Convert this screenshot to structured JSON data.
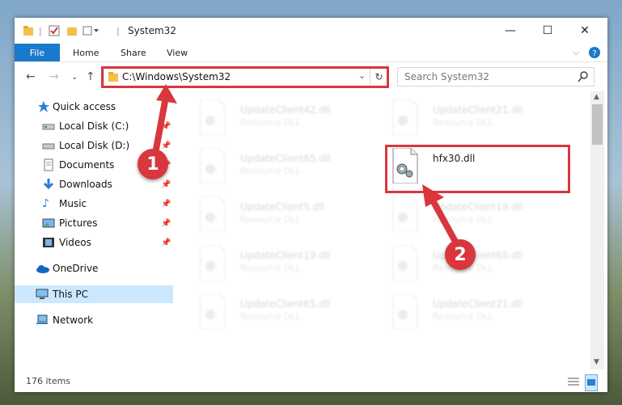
{
  "window": {
    "title": "System32",
    "controls": {
      "minimize": "—",
      "maximize": "☐",
      "close": "✕"
    }
  },
  "ribbon": {
    "tabs": [
      "File",
      "Home",
      "Share",
      "View"
    ]
  },
  "nav": {
    "address": "C:\\Windows\\System32",
    "search_placeholder": "Search System32"
  },
  "sidebar": {
    "items": [
      {
        "label": "Quick access",
        "icon": "star-icon"
      },
      {
        "label": "Local Disk (C:)",
        "icon": "drive-icon",
        "pinned": true
      },
      {
        "label": "Local Disk (D:)",
        "icon": "drive-icon",
        "pinned": true
      },
      {
        "label": "Documents",
        "icon": "documents-icon",
        "pinned": true
      },
      {
        "label": "Downloads",
        "icon": "download-icon",
        "pinned": true
      },
      {
        "label": "Music",
        "icon": "music-icon",
        "pinned": true
      },
      {
        "label": "Pictures",
        "icon": "pictures-icon",
        "pinned": true
      },
      {
        "label": "Videos",
        "icon": "videos-icon",
        "pinned": true
      },
      {
        "label": "OneDrive",
        "icon": "cloud-icon"
      },
      {
        "label": "This PC",
        "icon": "computer-icon",
        "selected": true
      },
      {
        "label": "Network",
        "icon": "network-icon"
      }
    ]
  },
  "files": [
    {
      "name": "UpdateClient42.dll",
      "type": "Resource DLL"
    },
    {
      "name": "UpdateClient21.dll",
      "type": "Resource DLL"
    },
    {
      "name": "UpdateClient65.dll",
      "type": "Resource DLL"
    },
    {
      "name": "hfx30.dll",
      "type": ""
    },
    {
      "name": "UpdateClient5.dll",
      "type": "Resource DLL"
    },
    {
      "name": "UpdateClient19.dll",
      "type": "Resource DLL"
    },
    {
      "name": "UpdateClient19.dll",
      "type": "Resource DLL"
    },
    {
      "name": "UpdateClient65.dll",
      "type": "Resource DLL"
    },
    {
      "name": "UpdateClient65.dll",
      "type": "Resource DLL"
    },
    {
      "name": "UpdateClient21.dll",
      "type": "Resource DLL"
    }
  ],
  "status": {
    "items_count": "176 items"
  },
  "annotations": {
    "step1": "1",
    "step2": "2"
  },
  "colors": {
    "accent": "#1979ca",
    "highlight": "#d9363e",
    "selected_bg": "#cce8ff"
  }
}
